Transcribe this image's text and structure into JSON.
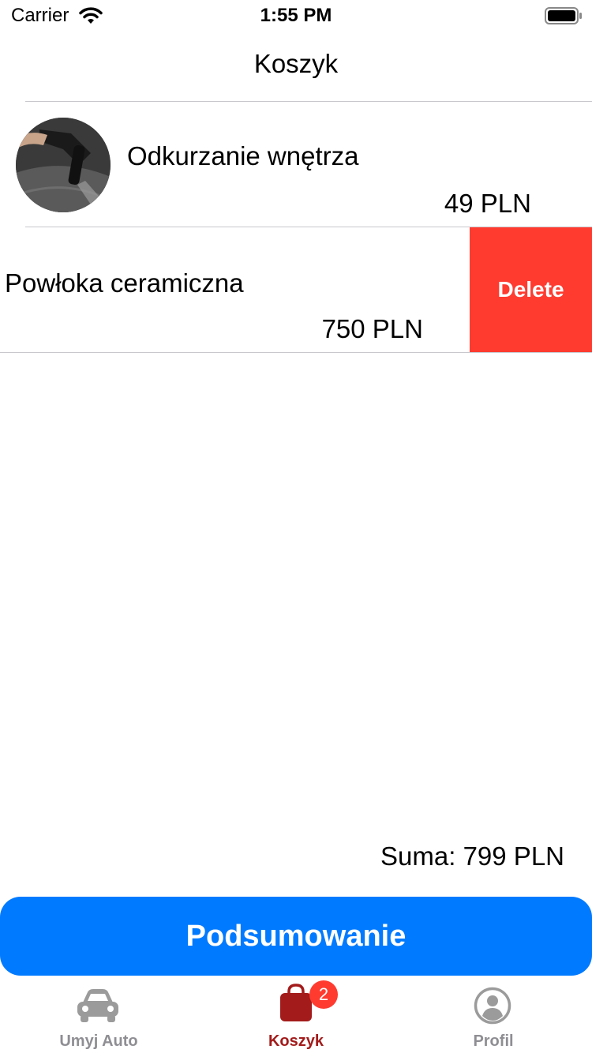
{
  "status_bar": {
    "carrier": "Carrier",
    "time": "1:55 PM"
  },
  "nav": {
    "title": "Koszyk"
  },
  "cart_items": [
    {
      "title": "Odkurzanie wnętrza",
      "price": "49 PLN",
      "image": "vacuum-photo"
    },
    {
      "title": "Powłoka ceramiczna",
      "price": "750 PLN"
    }
  ],
  "row_actions": {
    "delete_label": "Delete"
  },
  "summary": {
    "total": "Suma: 799 PLN",
    "button_label": "Podsumowanie"
  },
  "tabs": [
    {
      "label": "Umyj Auto",
      "icon": "car-icon",
      "active": false
    },
    {
      "label": "Koszyk",
      "icon": "bag-icon",
      "active": true,
      "badge": "2"
    },
    {
      "label": "Profil",
      "icon": "person-circle-icon",
      "active": false
    }
  ],
  "colors": {
    "accent": "#007aff",
    "delete": "#ff3b30",
    "active_tab": "#a31b1b",
    "inactive_tab": "#8e8e93"
  }
}
